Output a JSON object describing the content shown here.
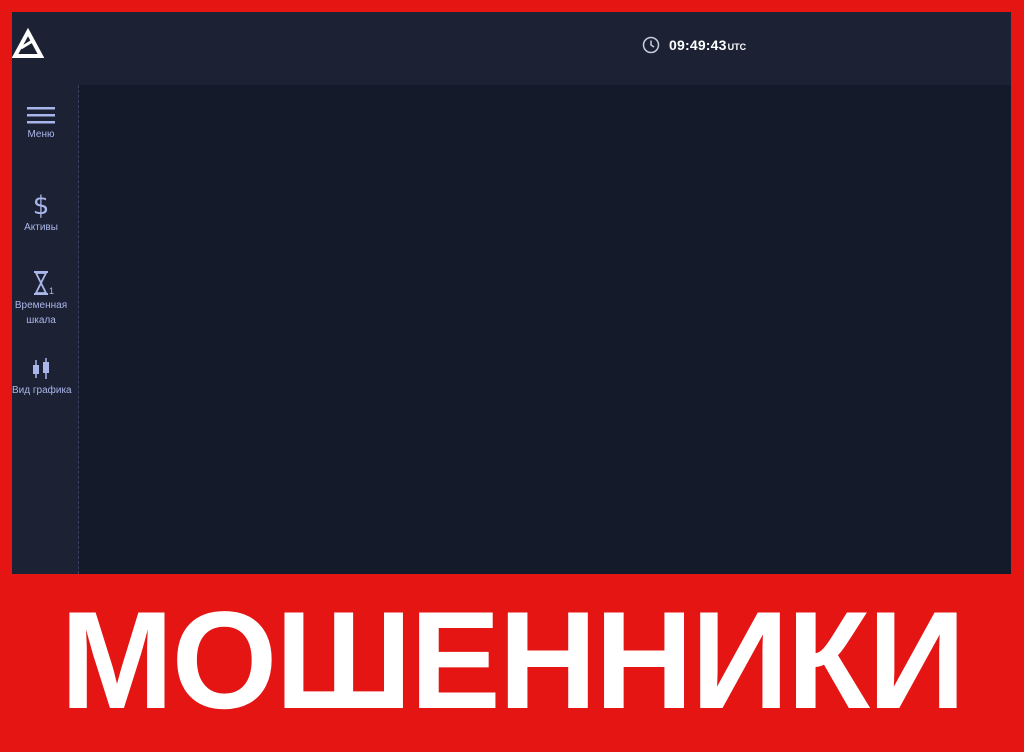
{
  "topbar": {
    "clock": {
      "icon": "clock-icon",
      "time": "09:49:43",
      "timezone": "UTC"
    }
  },
  "sidebar": {
    "items": [
      {
        "icon": "menu-icon",
        "label": "Меню"
      },
      {
        "icon": "dollar-icon",
        "label": "Активы"
      },
      {
        "icon": "hourglass-icon",
        "label_line1": "Временная",
        "label_line2": "шкала",
        "badge": "1"
      },
      {
        "icon": "candlestick-icon",
        "label": "Вид графика"
      }
    ]
  },
  "banner": {
    "text": "МОШЕННИКИ"
  },
  "colors": {
    "banner_red": "#e41513",
    "app_background": "#151a2a",
    "panel_background": "#1c2133",
    "sidebar_text": "#aab6ea"
  }
}
